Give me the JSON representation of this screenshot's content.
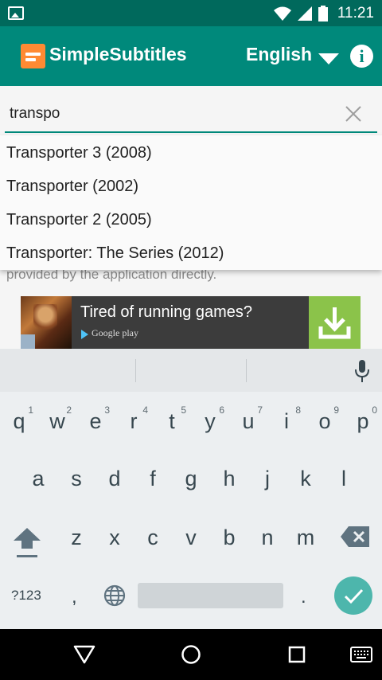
{
  "status_bar": {
    "time": "11:21"
  },
  "app_bar": {
    "title": "SimpleSubtitles",
    "language": "English"
  },
  "search": {
    "value": "transpo"
  },
  "suggestions": [
    "Transporter 3 (2008)",
    "Transporter (2002)",
    "Transporter 2 (2005)",
    "Transporter: The Series (2012)"
  ],
  "content": {
    "partial_text": "provided by the application directly."
  },
  "ad": {
    "title": "Tired of running games?",
    "store": "Google play"
  },
  "keyboard": {
    "row1": [
      {
        "char": "q",
        "hint": "1"
      },
      {
        "char": "w",
        "hint": "2"
      },
      {
        "char": "e",
        "hint": "3"
      },
      {
        "char": "r",
        "hint": "4"
      },
      {
        "char": "t",
        "hint": "5"
      },
      {
        "char": "y",
        "hint": "6"
      },
      {
        "char": "u",
        "hint": "7"
      },
      {
        "char": "i",
        "hint": "8"
      },
      {
        "char": "o",
        "hint": "9"
      },
      {
        "char": "p",
        "hint": "0"
      }
    ],
    "row2": [
      "a",
      "s",
      "d",
      "f",
      "g",
      "h",
      "j",
      "k",
      "l"
    ],
    "row3": [
      "z",
      "x",
      "c",
      "v",
      "b",
      "n",
      "m"
    ],
    "symbols_label": "?123",
    "comma": ",",
    "period": "."
  },
  "colors": {
    "primary": "#00897b",
    "primary_dark": "#00695c",
    "accent": "#ff8a33",
    "keyboard_action": "#4db6ac",
    "ad_download": "#8bc34a"
  }
}
